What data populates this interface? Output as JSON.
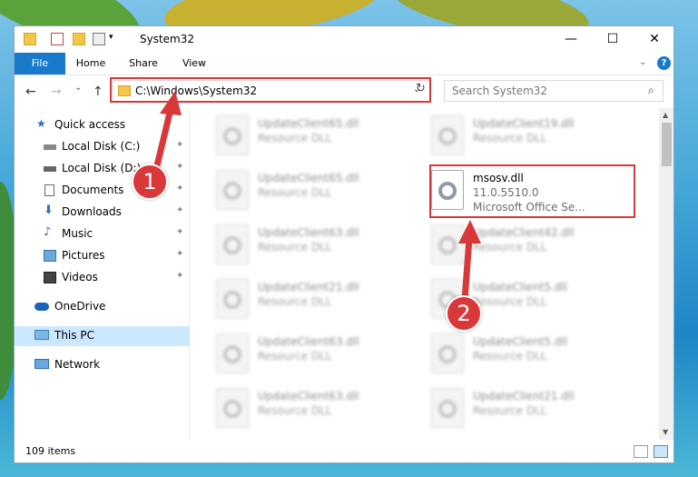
{
  "window": {
    "title": "System32",
    "controls": {
      "minimize": "—",
      "maximize": "☐",
      "close": "✕"
    }
  },
  "ribbon": {
    "tabs": [
      {
        "label": "File"
      },
      {
        "label": "Home"
      },
      {
        "label": "Share"
      },
      {
        "label": "View"
      }
    ],
    "help": "?"
  },
  "nav": {
    "back": "←",
    "forward": "→",
    "recent": "⌄",
    "up": "↑",
    "address": "C:\\Windows\\System32",
    "refresh": "↻",
    "search_placeholder": "Search System32"
  },
  "navpane": {
    "quick_access": "Quick access",
    "items": [
      {
        "label": "Local Disk (C:)"
      },
      {
        "label": "Local Disk (D:)"
      },
      {
        "label": "Documents"
      },
      {
        "label": "Downloads"
      },
      {
        "label": "Music"
      },
      {
        "label": "Pictures"
      },
      {
        "label": "Videos"
      }
    ],
    "onedrive": "OneDrive",
    "this_pc": "This PC",
    "network": "Network"
  },
  "files": [
    {
      "name": "UpdateClient65.dll",
      "type": "Resource DLL"
    },
    {
      "name": "UpdateClient19.dll",
      "type": "Resource DLL"
    },
    {
      "name": "UpdateClient65.dll",
      "type": "Resource DLL"
    },
    {
      "name": "msosv.dll",
      "version": "11.0.5510.0",
      "description": "Microsoft Office Se..."
    },
    {
      "name": "UpdateClient63.dll",
      "type": "Resource DLL"
    },
    {
      "name": "UpdateClient42.dll",
      "type": "Resource DLL"
    },
    {
      "name": "UpdateClient21.dll",
      "type": "Resource DLL"
    },
    {
      "name": "UpdateClient5.dll",
      "type": "Resource DLL"
    },
    {
      "name": "UpdateClient63.dll",
      "type": "Resource DLL"
    },
    {
      "name": "UpdateClient5.dll",
      "type": "Resource DLL"
    },
    {
      "name": "UpdateClient63.dll",
      "type": "Resource DLL"
    },
    {
      "name": "UpdateClient21.dll",
      "type": "Resource DLL"
    }
  ],
  "status": {
    "item_count": "109 items"
  },
  "annotations": {
    "step1": "1",
    "step2": "2"
  },
  "colors": {
    "accent": "#1979ca",
    "highlight_red": "#d9383a",
    "selected": "#cce8ff"
  }
}
